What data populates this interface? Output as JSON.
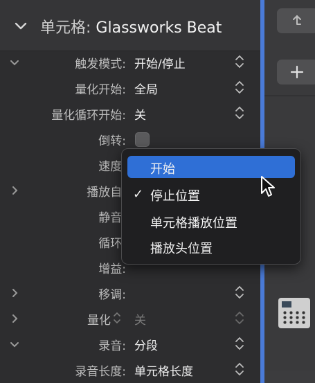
{
  "header": {
    "label": "单元格:",
    "title": "Glassworks Beat"
  },
  "rows": [
    {
      "label": "触发模式:",
      "value": "开始/停止"
    },
    {
      "label": "量化开始:",
      "value": "全局"
    },
    {
      "label": "量化循环开始:",
      "value": "关"
    },
    {
      "label": "倒转:"
    },
    {
      "label": "速度:"
    },
    {
      "label": "播放自:"
    },
    {
      "label": "静音:"
    },
    {
      "label": "循环:"
    },
    {
      "label": "增益:"
    },
    {
      "label": "移调:"
    },
    {
      "label": "量化",
      "value": "关"
    },
    {
      "label": "录音:",
      "value": "分段"
    },
    {
      "label": "录音长度:",
      "value": "单元格长度"
    }
  ],
  "menu": {
    "items": [
      {
        "label": "开始",
        "highlighted": true
      },
      {
        "label": "停止位置",
        "checked": true,
        "check": "✓"
      },
      {
        "label": "单元格播放位置"
      },
      {
        "label": "播放头位置"
      }
    ]
  },
  "icons": {
    "header_chevron": "chevron-down-icon",
    "tracks_top_button": "arrow-up-icon",
    "tracks_add_button": "plus-icon"
  },
  "colors": {
    "highlight": "#2f6fd6",
    "selection_edge": "#4a7bd8"
  }
}
